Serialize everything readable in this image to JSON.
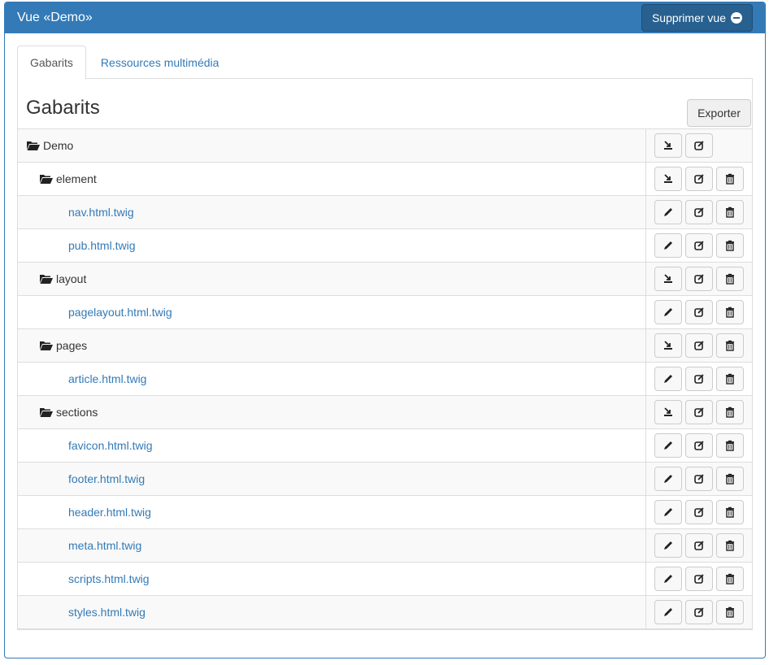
{
  "header": {
    "title": "Vue «Demo»",
    "delete_view_label": "Supprimer vue"
  },
  "tabs": [
    {
      "label": "Gabarits",
      "active": true
    },
    {
      "label": "Ressources multimédia",
      "active": false
    }
  ],
  "section": {
    "title": "Gabarits",
    "export_label": "Exporter"
  },
  "tree": [
    {
      "name": "Demo",
      "type": "folder",
      "level": 0,
      "actions": [
        "upload-icon",
        "edit-icon"
      ]
    },
    {
      "name": "element",
      "type": "folder",
      "level": 1,
      "actions": [
        "upload-icon",
        "edit-icon",
        "trash-icon"
      ]
    },
    {
      "name": "nav.html.twig",
      "type": "file",
      "level": 2,
      "actions": [
        "pencil-icon",
        "edit-icon",
        "trash-icon"
      ]
    },
    {
      "name": "pub.html.twig",
      "type": "file",
      "level": 2,
      "actions": [
        "pencil-icon",
        "edit-icon",
        "trash-icon"
      ]
    },
    {
      "name": "layout",
      "type": "folder",
      "level": 1,
      "actions": [
        "upload-icon",
        "edit-icon",
        "trash-icon"
      ]
    },
    {
      "name": "pagelayout.html.twig",
      "type": "file",
      "level": 2,
      "actions": [
        "pencil-icon",
        "edit-icon",
        "trash-icon"
      ]
    },
    {
      "name": "pages",
      "type": "folder",
      "level": 1,
      "actions": [
        "upload-icon",
        "edit-icon",
        "trash-icon"
      ]
    },
    {
      "name": "article.html.twig",
      "type": "file",
      "level": 2,
      "actions": [
        "pencil-icon",
        "edit-icon",
        "trash-icon"
      ]
    },
    {
      "name": "sections",
      "type": "folder",
      "level": 1,
      "actions": [
        "upload-icon",
        "edit-icon",
        "trash-icon"
      ]
    },
    {
      "name": "favicon.html.twig",
      "type": "file",
      "level": 2,
      "actions": [
        "pencil-icon",
        "edit-icon",
        "trash-icon"
      ]
    },
    {
      "name": "footer.html.twig",
      "type": "file",
      "level": 2,
      "actions": [
        "pencil-icon",
        "edit-icon",
        "trash-icon"
      ]
    },
    {
      "name": "header.html.twig",
      "type": "file",
      "level": 2,
      "actions": [
        "pencil-icon",
        "edit-icon",
        "trash-icon"
      ]
    },
    {
      "name": "meta.html.twig",
      "type": "file",
      "level": 2,
      "actions": [
        "pencil-icon",
        "edit-icon",
        "trash-icon"
      ]
    },
    {
      "name": "scripts.html.twig",
      "type": "file",
      "level": 2,
      "actions": [
        "pencil-icon",
        "edit-icon",
        "trash-icon"
      ]
    },
    {
      "name": "styles.html.twig",
      "type": "file",
      "level": 2,
      "actions": [
        "pencil-icon",
        "edit-icon",
        "trash-icon"
      ]
    }
  ],
  "colors": {
    "primary": "#337ab7",
    "primary_dark": "#286090",
    "link": "#337ab7",
    "border": "#dddddd"
  }
}
